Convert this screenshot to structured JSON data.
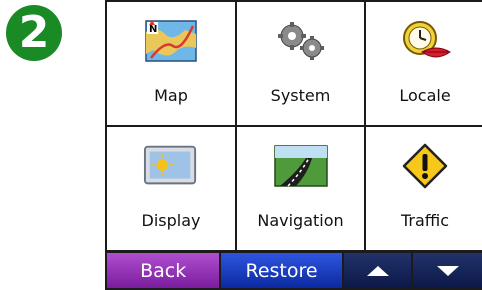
{
  "step_badge": "2",
  "tiles": [
    {
      "label": "Map",
      "icon": "map-icon"
    },
    {
      "label": "System",
      "icon": "gears-icon"
    },
    {
      "label": "Locale",
      "icon": "clock-lips-icon"
    },
    {
      "label": "Display",
      "icon": "sun-moon-icon"
    },
    {
      "label": "Navigation",
      "icon": "road-icon"
    },
    {
      "label": "Traffic",
      "icon": "warning-icon"
    }
  ],
  "toolbar": {
    "back_label": "Back",
    "restore_label": "Restore",
    "up_icon": "arrow-up-icon",
    "down_icon": "arrow-down-icon"
  },
  "colors": {
    "badge": "#1a8a25",
    "back": "#8a2bb0",
    "restore": "#1a3fcf",
    "scroll": "#14225a"
  }
}
